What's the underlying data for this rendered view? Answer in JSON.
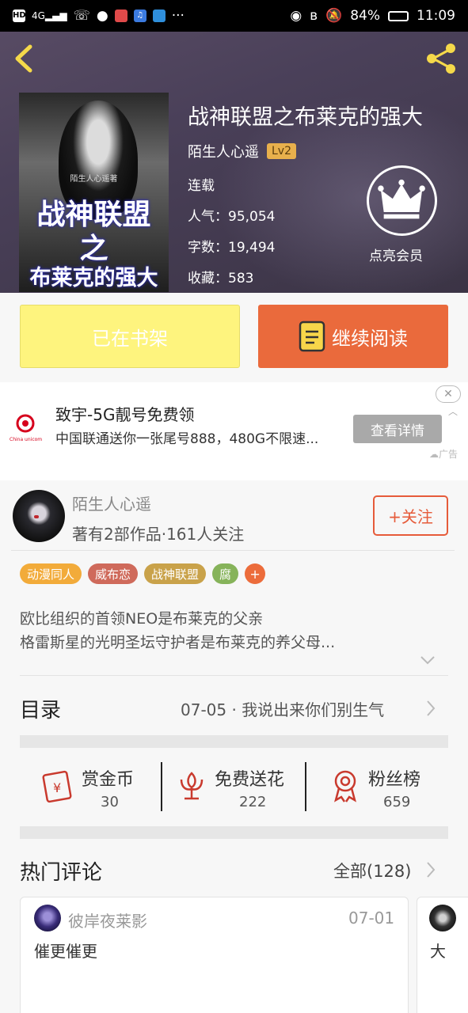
{
  "status_bar": {
    "left_icons": [
      "hd-icon",
      "4g-signal-icon",
      "missed-call-icon",
      "message-icon",
      "app-red-icon",
      "music-app-icon",
      "store-app-icon",
      "more-dots-icon"
    ],
    "battery": "84%",
    "time": "11:09"
  },
  "book": {
    "title": "战神联盟之布莱克的强大",
    "author": "陌生人心遥",
    "level": "Lv2",
    "status": "连载",
    "popularity": "人气：95,054",
    "word_count": "字数：19,494",
    "favorites": "收藏：583",
    "cover_text": {
      "small": "陌生人心遥著",
      "line1": "战神联盟",
      "line2": "之",
      "line3": "布莱克的强大"
    }
  },
  "vip": {
    "label": "点亮会员"
  },
  "actions": {
    "shelf": "已在书架",
    "read": "继续阅读"
  },
  "ad": {
    "title": "致宇-5G靓号免费领",
    "desc": "中国联通送你一张尾号888，480G不限速...",
    "button": "查看详情",
    "close": "✕",
    "tag": "广告"
  },
  "author_card": {
    "name": "陌生人心遥",
    "sub": "著有2部作品·161人关注",
    "follow": "+关注"
  },
  "tags": [
    {
      "label": "动漫同人",
      "color": "#f2ab3a"
    },
    {
      "label": "威布恋",
      "color": "#cf6a5b"
    },
    {
      "label": "战神联盟",
      "color": "#c9a24a"
    },
    {
      "label": "腐",
      "color": "#86b35a"
    }
  ],
  "tag_more": "+",
  "description": {
    "line1": "欧比组织的首领NEO是布莱克的父亲",
    "line2": "格雷斯星的光明圣坛守护者是布莱克的养父母..."
  },
  "toc": {
    "label": "目录",
    "latest": "07-05 · 我说出来你们别生气"
  },
  "stats": [
    {
      "label": "赏金币",
      "value": "30",
      "icon": "red-envelope-icon"
    },
    {
      "label": "免费送花",
      "value": "222",
      "icon": "flower-icon"
    },
    {
      "label": "粉丝榜",
      "value": "659",
      "icon": "medal-icon"
    }
  ],
  "comments": {
    "label": "热门评论",
    "all": "全部(128)",
    "items": [
      {
        "user": "彼岸夜莱影",
        "date": "07-01",
        "text": "催更催更"
      },
      {
        "user": "",
        "date": "",
        "text": "大"
      }
    ]
  },
  "colors": {
    "accent": "#ea6a3c",
    "shelf": "#fef47e",
    "header": "#4a4059"
  }
}
